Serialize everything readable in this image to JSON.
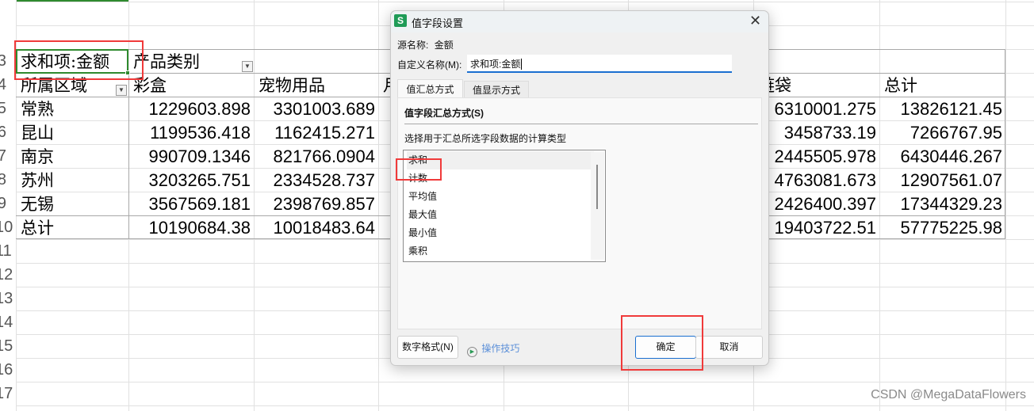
{
  "sheet": {
    "row_numbers": [
      "3",
      "4",
      "5",
      "6",
      "7",
      "8",
      "9",
      "10",
      "11",
      "12",
      "13",
      "14",
      "15",
      "16",
      "17"
    ],
    "pivot_value_field": "求和项:金额",
    "column_field": "产品类别",
    "row_field": "所属区域",
    "columns": [
      "彩盒",
      "宠物用品",
      "月",
      "链袋",
      "总计"
    ],
    "rows": [
      {
        "label": "常熟",
        "values": [
          "1229603.898",
          "3301003.689",
          "6310001.275",
          "13826121.45"
        ]
      },
      {
        "label": "昆山",
        "values": [
          "1199536.418",
          "1162415.271",
          "3458733.19",
          "7266767.95"
        ]
      },
      {
        "label": "南京",
        "values": [
          "990709.1346",
          "821766.0904",
          "2445505.978",
          "6430446.267"
        ]
      },
      {
        "label": "苏州",
        "values": [
          "3203265.751",
          "2334528.737",
          "4763081.673",
          "12907561.07"
        ]
      },
      {
        "label": "无锡",
        "values": [
          "3567569.181",
          "2398769.857",
          "2426400.397",
          "17344329.23"
        ]
      },
      {
        "label": "总计",
        "values": [
          "10190684.38",
          "10018483.64",
          "19403722.51",
          "57775225.98"
        ]
      }
    ]
  },
  "dialog": {
    "title": "值字段设置",
    "app_icon": "S",
    "source_label": "源名称:",
    "source_value": "金额",
    "custom_name_label": "自定义名称(M):",
    "custom_name_value": "求和项:金额",
    "tabs": [
      {
        "label": "值汇总方式",
        "active": true
      },
      {
        "label": "值显示方式",
        "active": false
      }
    ],
    "section_title": "值字段汇总方式(S)",
    "description": "选择用于汇总所选字段数据的计算类型",
    "options": [
      "求和",
      "计数",
      "平均值",
      "最大值",
      "最小值",
      "乘积"
    ],
    "selected_option": "求和",
    "number_format_button": "数字格式(N)",
    "tips_link": "操作技巧",
    "ok_button": "确定",
    "cancel_button": "取消"
  },
  "watermark": "CSDN @MegaDataFlowers",
  "colors": {
    "selection": "#2f8a2f",
    "annotation": "#f03a3a",
    "accent": "#1a6fd0",
    "app_icon": "#1f9b57"
  }
}
